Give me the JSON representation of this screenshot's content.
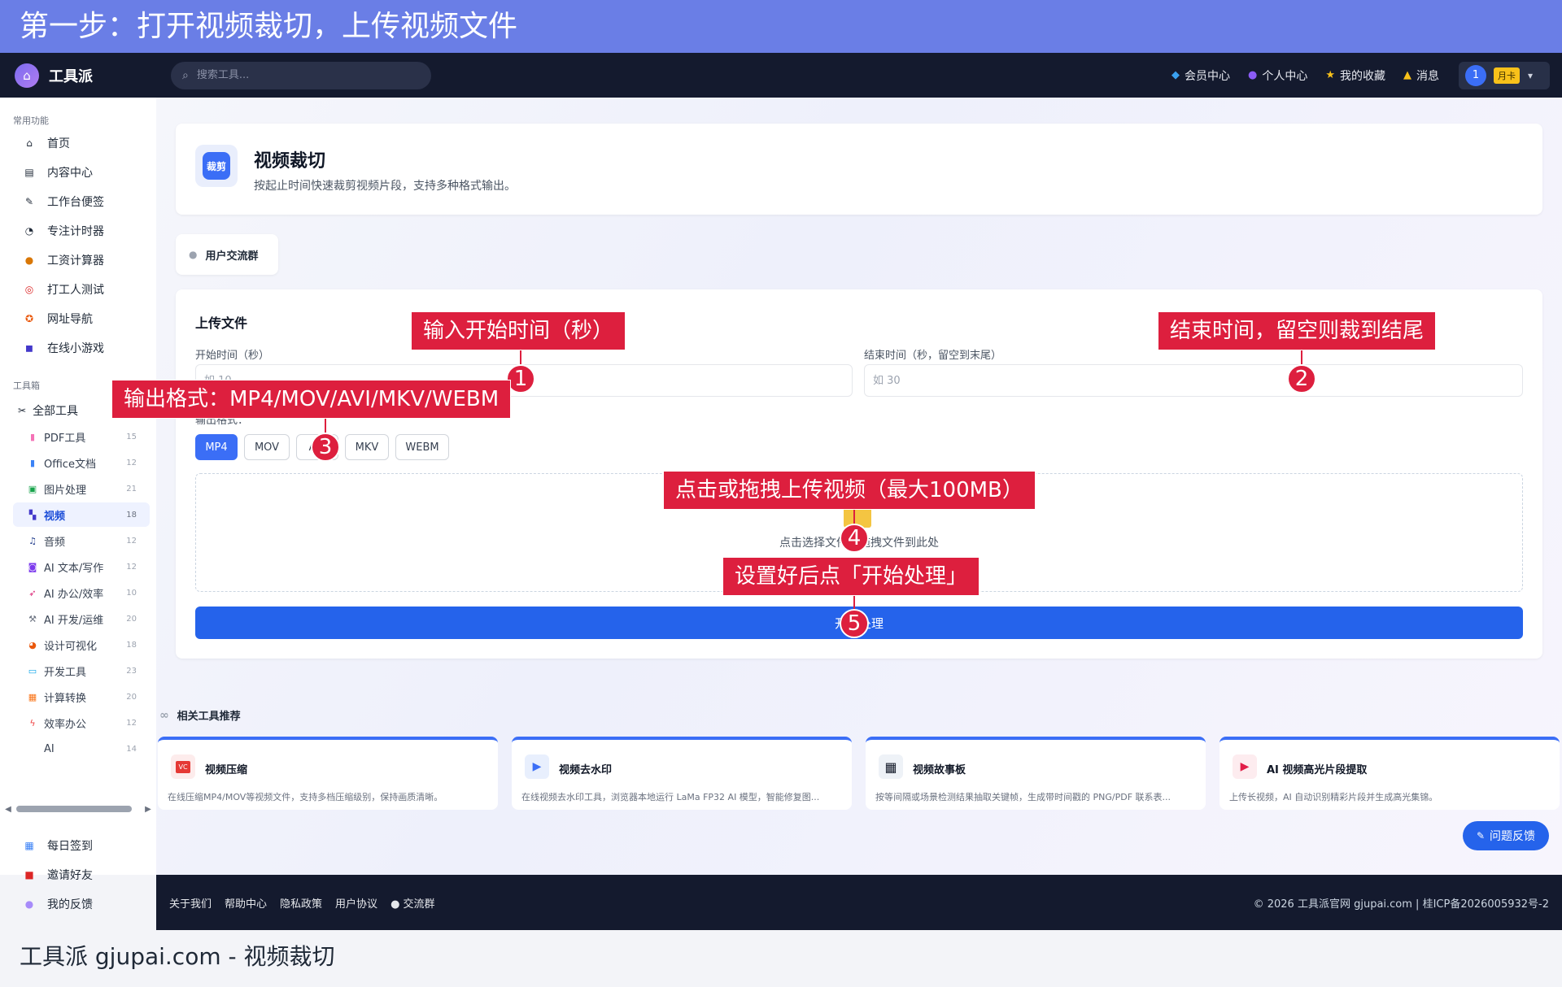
{
  "banner": {
    "text": "第一步：打开视频裁切，上传视频文件"
  },
  "header": {
    "app_name": "工具派",
    "search_placeholder": "搜索工具...",
    "nav": [
      {
        "label": "会员中心",
        "icon": "diamond-icon"
      },
      {
        "label": "个人中心",
        "icon": "user-icon"
      },
      {
        "label": "我的收藏",
        "icon": "star-icon"
      },
      {
        "label": "消息",
        "icon": "bell-icon"
      }
    ],
    "user": {
      "avatar": "1",
      "badge": "月卡"
    }
  },
  "sidebar": {
    "common_title": "常用功能",
    "common": [
      {
        "label": "首页",
        "icon": "home-icon"
      },
      {
        "label": "内容中心",
        "icon": "newspaper-icon"
      },
      {
        "label": "工作台便签",
        "icon": "note-icon"
      },
      {
        "label": "专注计时器",
        "icon": "stopwatch-icon"
      },
      {
        "label": "工资计算器",
        "icon": "money-bag-icon"
      },
      {
        "label": "打工人测试",
        "icon": "target-icon"
      },
      {
        "label": "网址导航",
        "icon": "compass-icon"
      },
      {
        "label": "在线小游戏",
        "icon": "gamepad-icon"
      }
    ],
    "tools_title": "工具箱",
    "all_tools": "全部工具",
    "tools": [
      {
        "label": "PDF工具",
        "count": "15",
        "icon": "pdf-icon"
      },
      {
        "label": "Office文档",
        "count": "12",
        "icon": "document-icon"
      },
      {
        "label": "图片处理",
        "count": "21",
        "icon": "image-icon"
      },
      {
        "label": "视频",
        "count": "18",
        "icon": "clapper-icon",
        "active": true
      },
      {
        "label": "音频",
        "count": "12",
        "icon": "music-icon"
      },
      {
        "label": "AI 文本/写作",
        "count": "12",
        "icon": "robot-icon"
      },
      {
        "label": "AI 办公/效率",
        "count": "10",
        "icon": "rocket-icon"
      },
      {
        "label": "AI 开发/运维",
        "count": "20",
        "icon": "wrench-icon"
      },
      {
        "label": "设计可视化",
        "count": "18",
        "icon": "palette-icon"
      },
      {
        "label": "开发工具",
        "count": "23",
        "icon": "monitor-icon"
      },
      {
        "label": "计算转换",
        "count": "20",
        "icon": "calculator-icon"
      },
      {
        "label": "效率办公",
        "count": "12",
        "icon": "lightning-icon"
      },
      {
        "label": "AI",
        "count": "14",
        "icon": ""
      }
    ],
    "bottom": [
      {
        "label": "每日签到",
        "icon": "calendar-icon"
      },
      {
        "label": "邀请好友",
        "icon": "gift-icon"
      },
      {
        "label": "我的反馈",
        "icon": "chat-icon"
      }
    ]
  },
  "tool": {
    "badge": "裁剪",
    "title": "视频裁切",
    "desc": "按起止时间快速裁剪视频片段，支持多种格式输出。",
    "group_button": "用户交流群"
  },
  "upload": {
    "title": "上传文件",
    "start_label": "开始时间（秒）",
    "start_placeholder": "如 10",
    "end_label": "结束时间（秒，留空到末尾）",
    "end_placeholder": "如 30",
    "format_label": "输出格式：",
    "formats": [
      "MP4",
      "MOV",
      "AVI",
      "MKV",
      "WEBM"
    ],
    "selected_format": "MP4",
    "dropzone_text": "点击选择文件或拖拽文件到此处",
    "start_button": "开始处理"
  },
  "related": {
    "title": "相关工具推荐",
    "items": [
      {
        "name": "视频压缩",
        "desc": "在线压缩MP4/MOV等视频文件，支持多档压缩级别，保持画质清晰。",
        "icon": "video-compress-icon"
      },
      {
        "name": "视频去水印",
        "desc": "在线视频去水印工具，浏览器本地运行 LaMa FP32 AI 模型，智能修复图...",
        "icon": "video-watermark-icon"
      },
      {
        "name": "视频故事板",
        "desc": "按等间隔或场景检测结果抽取关键帧，生成带时间戳的 PNG/PDF 联系表...",
        "icon": "storyboard-icon"
      },
      {
        "name": "AI 视频高光片段提取",
        "desc": "上传长视频，AI 自动识别精彩片段并生成高光集锦。",
        "icon": "highlight-icon"
      }
    ]
  },
  "feedback_button": "问题反馈",
  "footer": {
    "links": [
      "关于我们",
      "帮助中心",
      "隐私政策",
      "用户协议",
      "交流群"
    ],
    "copyright": "© 2026 工具派官网 gjupai.com | 桂ICP备2026005932号-2"
  },
  "caption": "工具派 gjupai.com - 视频裁切",
  "annotations": [
    {
      "number": "1",
      "text": "输入开始时间（秒）"
    },
    {
      "number": "2",
      "text": "结束时间，留空则裁到结尾"
    },
    {
      "number": "3",
      "text": "输出格式：MP4/MOV/AVI/MKV/WEBM"
    },
    {
      "number": "4",
      "text": "点击或拖拽上传视频（最大100MB）"
    },
    {
      "number": "5",
      "text": "设置好后点「开始处理」"
    }
  ],
  "colors": {
    "banner": "#6a7ee6",
    "header": "#141a2e",
    "primary": "#2563eb",
    "annotation": "#dd1f3e",
    "badge": "#f8c11a"
  }
}
